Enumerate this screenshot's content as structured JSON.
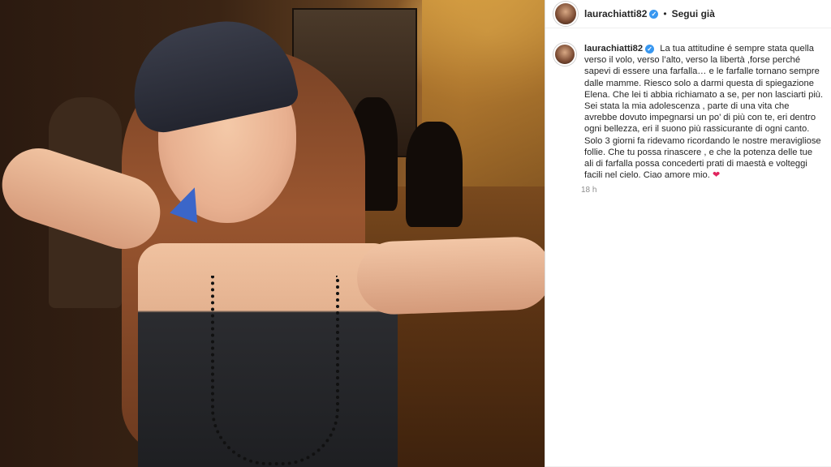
{
  "post": {
    "username": "laurachiatti82",
    "separator": "•",
    "follow_label": "Segui già",
    "caption_text": "La tua attitudine é sempre stata quella verso il volo, verso l’alto, verso la libertà ,forse perché sapevi di essere una farfalla… e le farfalle tornano sempre dalle mamme. Riesco solo a darmi questa di spiegazione Elena. Che lei ti abbia richiamato a se, per non lasciarti più. Sei stata la mia adolescenza , parte di una vita che avrebbe dovuto impegnarsi un po’ di più con te, eri dentro ogni bellezza, eri il suono più rassicurante di ogni canto. Solo 3 giorni fa ridevamo ricordando le nostre meravigliose follie. Che tu possa rinascere , e che la potenza delle tue ali di farfalla possa concederti prati di maestà e volteggi facili nel cielo. Ciao amore mio.",
    "heart": "❤",
    "time_ago": "18 h"
  },
  "colors": {
    "verified": "#3897f0",
    "heart": "#e0245e",
    "text": "#262626",
    "muted": "#8e8e8e"
  }
}
